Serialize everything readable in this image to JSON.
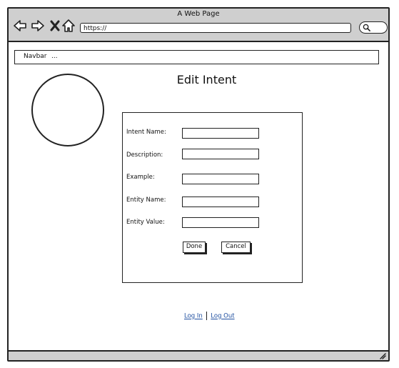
{
  "window": {
    "title": "A Web Page"
  },
  "browser": {
    "address": "https://",
    "icons": [
      "back-arrow-icon",
      "forward-arrow-icon",
      "close-x-icon",
      "home-icon",
      "search-icon"
    ]
  },
  "navbar": {
    "brand": "Navbar",
    "more": "..."
  },
  "page": {
    "title": "Edit Intent"
  },
  "form": {
    "fields": [
      {
        "label": "Intent Name:",
        "value": ""
      },
      {
        "label": "Description:",
        "value": ""
      },
      {
        "label": "Example:",
        "value": ""
      },
      {
        "label": "Entity Name:",
        "value": ""
      },
      {
        "label": "Entity Value:",
        "value": ""
      }
    ],
    "done_label": "Done",
    "cancel_label": "Cancel"
  },
  "footer": {
    "login_label": "Log In",
    "logout_label": "Log Out"
  }
}
